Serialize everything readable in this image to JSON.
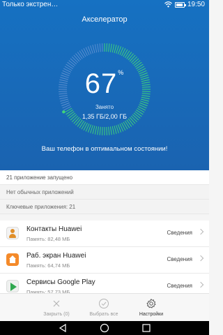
{
  "statusbar": {
    "left_text": "Только экстрен…",
    "time": "19:50"
  },
  "header": {
    "title": "Акселератор"
  },
  "memory": {
    "percent": "67",
    "percent_sign": "%",
    "used_fraction": 0.67,
    "used_label": "Занято",
    "used_value": "1,35 ГБ/2,00 ГБ"
  },
  "status_message": "Ваш телефон в оптимальном состоянии!",
  "info": {
    "running": "21 приложение запущено",
    "normal": "Нет обычных приложений",
    "key_apps": "Ключевые приложения: 21"
  },
  "apps": [
    {
      "name": "Контакты Huawei",
      "memory": "Память: 82,48 МБ",
      "details": "Сведения",
      "icon": "contacts-icon"
    },
    {
      "name": "Раб. экран Huawei",
      "memory": "Память: 64,74 МБ",
      "details": "Сведения",
      "icon": "home-icon"
    },
    {
      "name": "Сервисы Google Play",
      "memory": "Память: 57,73 МБ",
      "details": "Сведения",
      "icon": "play-services-icon"
    }
  ],
  "actions": {
    "close": "Закрыть (0)",
    "select_all": "Выбрать все",
    "settings": "Настройки"
  },
  "colors": {
    "hero_blue": "#1a6ab9",
    "gauge_green": "#3fd37a",
    "gauge_track": "#5b8fd0"
  }
}
